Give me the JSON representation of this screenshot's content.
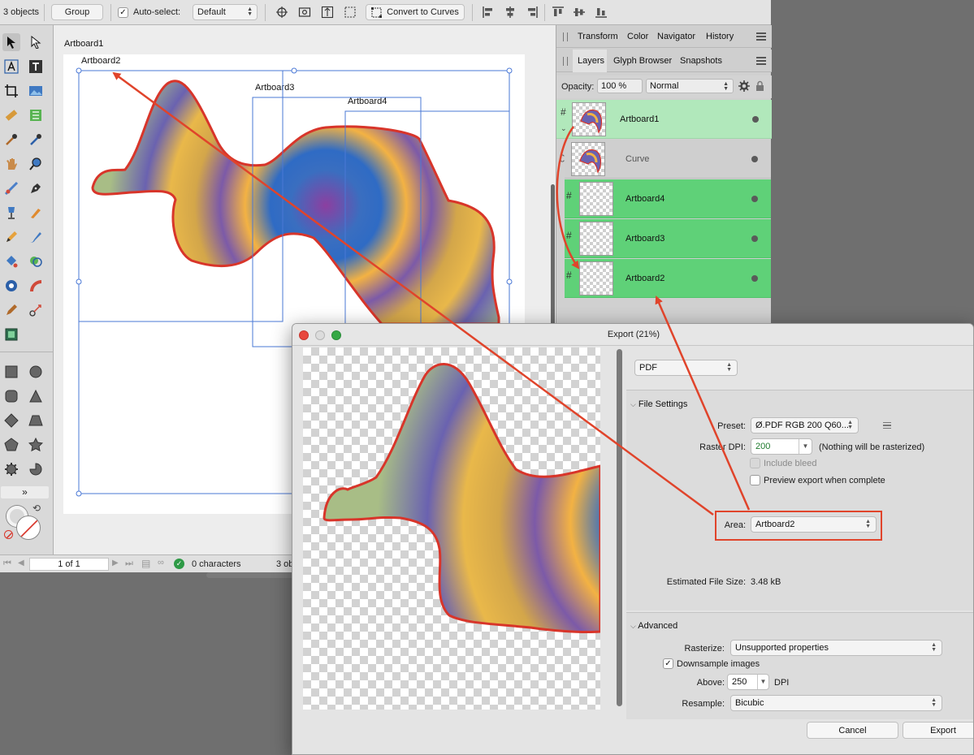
{
  "toolbar": {
    "objects_count": "3 objects",
    "group_label": "Group",
    "auto_select_label": "Auto-select:",
    "auto_select_value": "Default",
    "convert_to_curves_label": "Convert to Curves"
  },
  "canvas": {
    "artboards": [
      "Artboard1",
      "Artboard2",
      "Artboard3",
      "Artboard4"
    ]
  },
  "status_bar": {
    "page_indicator": "1 of 1",
    "characters": "0 characters",
    "objects_truncated": "3 ob"
  },
  "panels": {
    "top_tabs": [
      "Transform",
      "Color",
      "Navigator",
      "History"
    ],
    "second_tabs": [
      "Layers",
      "Glyph Browser",
      "Snapshots"
    ],
    "opacity_label": "Opacity:",
    "opacity_value": "100 %",
    "blend_mode": "Normal",
    "layers": [
      {
        "name": "Artboard1",
        "selected": true
      },
      {
        "name": "Curve",
        "selected": false
      },
      {
        "name": "Artboard4",
        "selected": false
      },
      {
        "name": "Artboard3",
        "selected": false
      },
      {
        "name": "Artboard2",
        "selected": false
      }
    ]
  },
  "export_dialog": {
    "title": "Export (21%)",
    "format": "PDF",
    "file_settings_header": "File Settings",
    "preset_label": "Preset:",
    "preset_value": "Ø.PDF RGB 200 Q60...",
    "raster_dpi_label": "Raster DPI:",
    "raster_dpi_value": "200",
    "raster_note": "(Nothing will be rasterized)",
    "include_bleed_label": "Include bleed",
    "preview_export_label": "Preview export when complete",
    "area_label": "Area:",
    "area_value": "Artboard2",
    "estimated_size_label": "Estimated File Size:",
    "estimated_size_value": "3.48 kB",
    "advanced_header": "Advanced",
    "rasterize_label": "Rasterize:",
    "rasterize_value": "Unsupported properties",
    "downsample_label": "Downsample images",
    "above_label": "Above:",
    "above_value": "250",
    "dpi_unit": "DPI",
    "resample_label": "Resample:",
    "resample_value": "Bicubic",
    "cancel_label": "Cancel",
    "export_label": "Export"
  },
  "colors": {
    "selection_blue": "#4a78d6",
    "layer_green": "#5fd178",
    "layer_selected_green": "#b1e8bb",
    "annotation_red": "#e0442b",
    "shape_outline": "#d8352a"
  }
}
